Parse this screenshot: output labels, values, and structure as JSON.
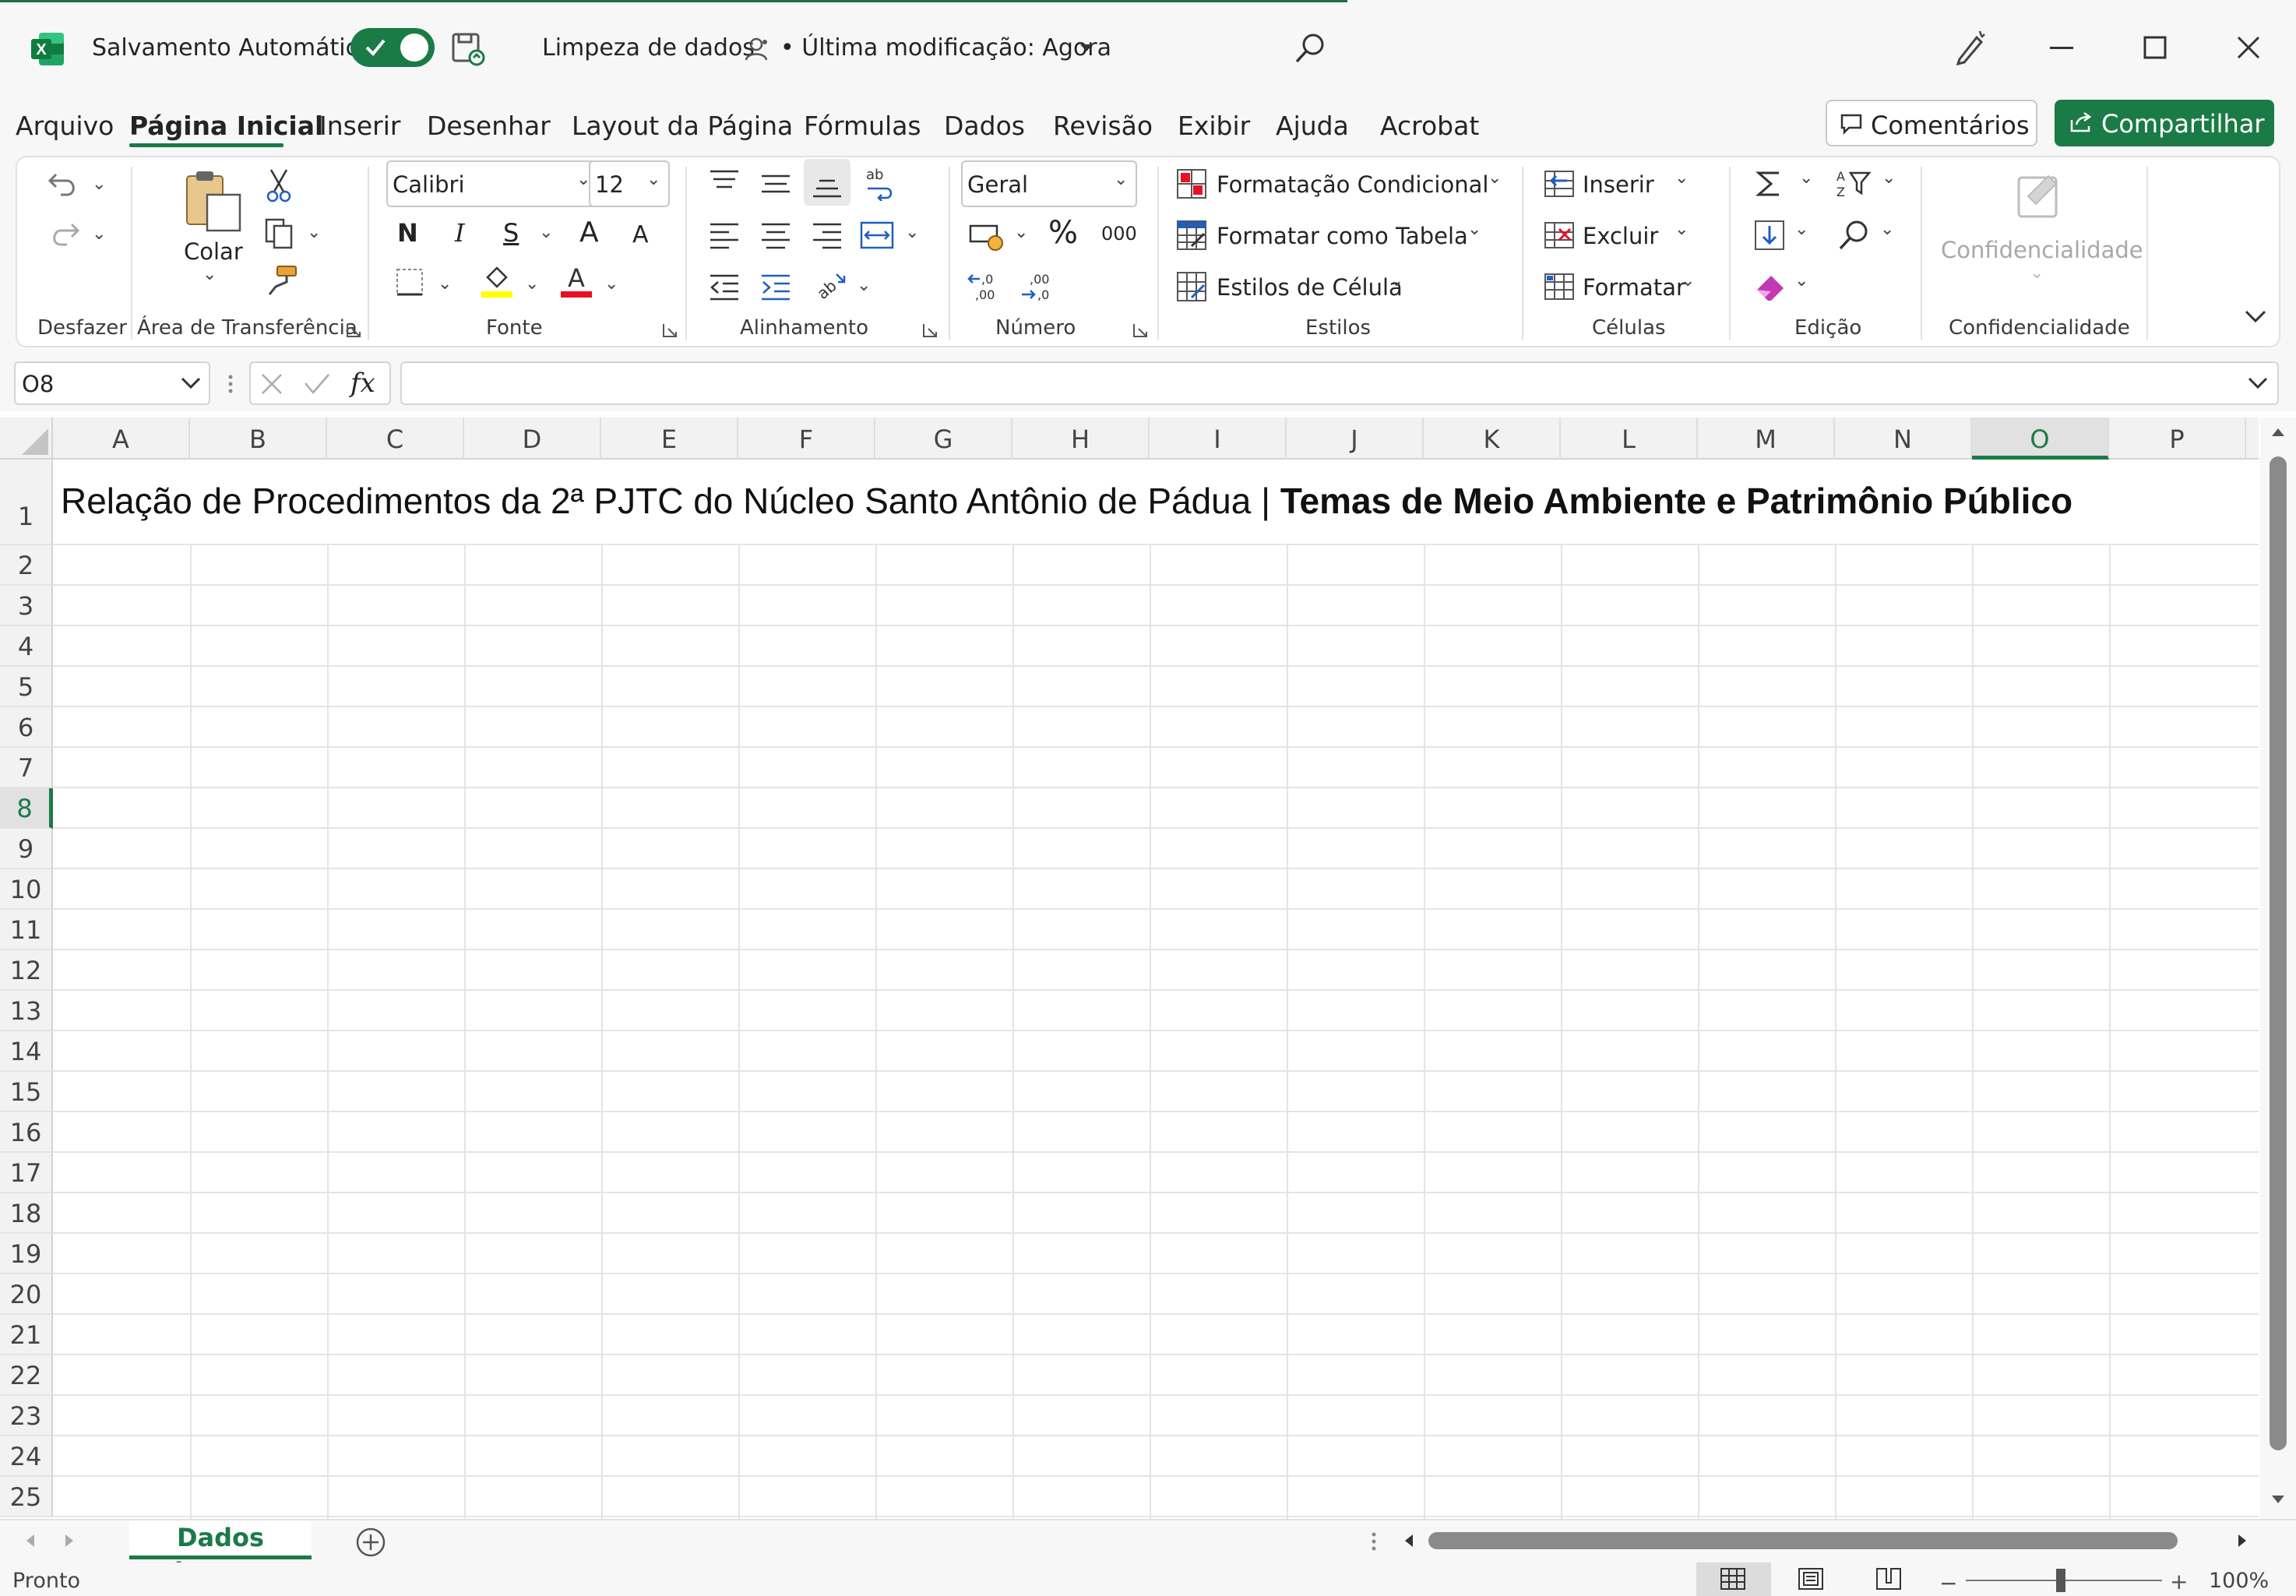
{
  "titlebar": {
    "autosave_label": "Salvamento Automático",
    "doc_title": "Limpeza de dados",
    "modified": "• Última modificação: Agora"
  },
  "menu": {
    "items": [
      "Arquivo",
      "Página Inicial",
      "Inserir",
      "Desenhar",
      "Layout da Página",
      "Fórmulas",
      "Dados",
      "Revisão",
      "Exibir",
      "Ajuda",
      "Acrobat"
    ],
    "active": "Página Inicial",
    "comments": "Comentários",
    "share": "Compartilhar"
  },
  "ribbon": {
    "undo_group": "Desfazer",
    "clipboard_group": "Área de Transferência",
    "paste": "Colar",
    "font_group": "Fonte",
    "font_name": "Calibri",
    "font_size": "12",
    "bold": "N",
    "italic": "I",
    "strike": "S",
    "grow": "A",
    "shrink": "A",
    "font_color_letter": "A",
    "alignment_group": "Alinhamento",
    "number_group": "Número",
    "number_format": "Geral",
    "percent": "%",
    "thousands": "000",
    "styles_group": "Estilos",
    "cond_format": "Formatação Condicional",
    "format_table": "Formatar como Tabela",
    "cell_styles": "Estilos de Célula",
    "cells_group": "Células",
    "insert": "Inserir",
    "delete": "Excluir",
    "format": "Formatar",
    "editing_group": "Edição",
    "sensitivity": "Confidencialidade",
    "sensitivity_group": "Confidencialidade",
    "colors": {
      "accent": "#1b7b46",
      "highlight": "#ffff00",
      "font_red": "#e81123"
    }
  },
  "formula_bar": {
    "name_box": "O8",
    "fx": "fx",
    "value": ""
  },
  "grid": {
    "columns": [
      "A",
      "B",
      "C",
      "D",
      "E",
      "F",
      "G",
      "H",
      "I",
      "J",
      "K",
      "L",
      "M",
      "N",
      "O",
      "P"
    ],
    "rows": [
      "1",
      "2",
      "3",
      "4",
      "5",
      "6",
      "7",
      "8",
      "9",
      "10",
      "11",
      "12",
      "13",
      "14",
      "15",
      "16",
      "17",
      "18",
      "19",
      "20",
      "21",
      "22",
      "23",
      "24",
      "25"
    ],
    "selected_col": "O",
    "selected_row": "8",
    "a1_normal": "Relação de Procedimentos da 2ª PJTC do Núcleo Santo Antônio de Pádua | ",
    "a1_bold": "Temas de Meio Ambiente e Patrimônio Público"
  },
  "sheets": {
    "tabs": [
      "Dados brutos"
    ],
    "active": "Dados brutos"
  },
  "status": {
    "ready": "Pronto",
    "zoom": "100%"
  }
}
